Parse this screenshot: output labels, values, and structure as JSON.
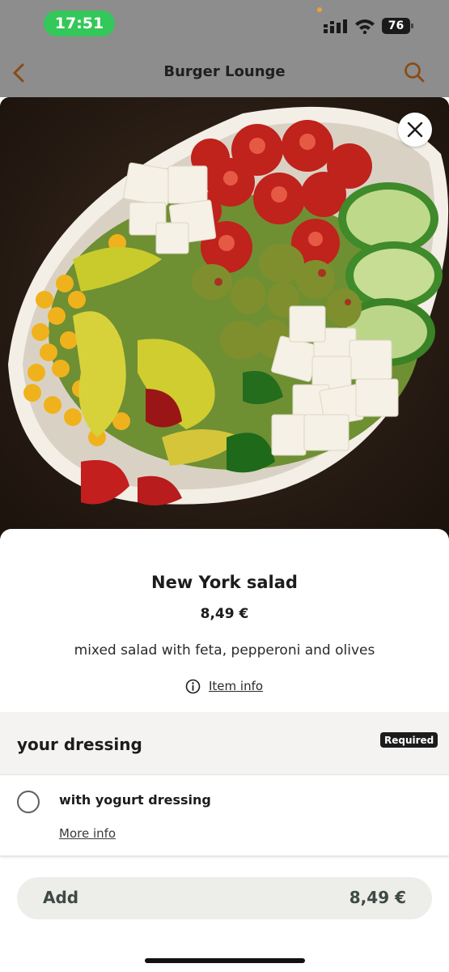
{
  "status_bar": {
    "time": "17:51",
    "battery": "76"
  },
  "nav": {
    "title": "Burger Lounge",
    "back_icon": "chevron-left-icon",
    "search_icon": "search-icon"
  },
  "colors": {
    "accent": "#b5651d",
    "time_pill": "#34c759",
    "badge": "#1c1c1c"
  },
  "item": {
    "name": "New York salad",
    "price": "8,49 €",
    "description": "mixed salad with feta, pepperoni and olives",
    "info_label": "Item info"
  },
  "dressing_section": {
    "title": "your dressing",
    "badge": "Required",
    "options": [
      {
        "label": "with yogurt dressing",
        "more_info": "More info",
        "selected": false
      }
    ]
  },
  "footer": {
    "add_label": "Add",
    "add_price": "8,49 €"
  }
}
